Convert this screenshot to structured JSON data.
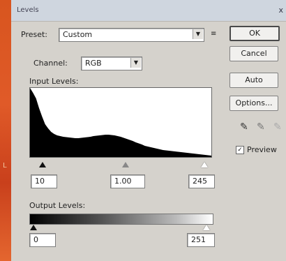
{
  "background": {
    "accent": "#e0431f",
    "text": "L"
  },
  "dialog": {
    "title": "Levels",
    "close_glyph": "x",
    "preset": {
      "label": "Preset:",
      "value": "Custom",
      "menu_icon": "≡"
    },
    "channel": {
      "label": "Channel:",
      "value": "RGB"
    },
    "input_levels": {
      "label": "Input Levels:",
      "black": "10",
      "gamma": "1.00",
      "white": "245"
    },
    "output_levels": {
      "label": "Output Levels:",
      "black": "0",
      "white": "251"
    },
    "buttons": {
      "ok": "OK",
      "cancel": "Cancel",
      "auto": "Auto",
      "options": "Options..."
    },
    "preview": {
      "label": "Preview",
      "checked": true
    },
    "histogram": [
      99,
      92,
      84,
      70,
      58,
      47,
      41,
      36,
      33,
      31,
      30,
      29,
      28.5,
      28,
      27.5,
      27,
      27,
      27.5,
      28,
      28.5,
      29,
      30,
      30.5,
      31,
      31.5,
      32,
      32,
      31.5,
      31,
      30,
      29,
      27.5,
      26,
      24.5,
      23,
      21,
      19.5,
      18,
      16,
      15,
      14,
      13,
      12,
      11,
      10,
      9.5,
      9,
      8.5,
      8,
      7.5,
      7,
      6.5,
      6,
      5.5,
      5,
      4.5,
      4,
      3.5,
      3,
      2.5,
      2
    ]
  }
}
